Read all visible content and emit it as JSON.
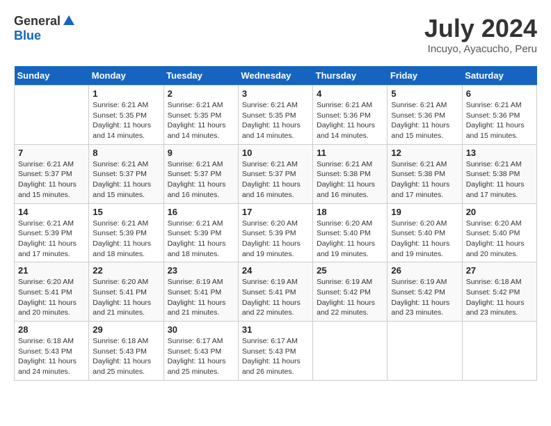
{
  "logo": {
    "general": "General",
    "blue": "Blue"
  },
  "title": {
    "month_year": "July 2024",
    "location": "Incuyo, Ayacucho, Peru"
  },
  "headers": [
    "Sunday",
    "Monday",
    "Tuesday",
    "Wednesday",
    "Thursday",
    "Friday",
    "Saturday"
  ],
  "weeks": [
    [
      {
        "day": "",
        "sunrise": "",
        "sunset": "",
        "daylight": ""
      },
      {
        "day": "1",
        "sunrise": "Sunrise: 6:21 AM",
        "sunset": "Sunset: 5:35 PM",
        "daylight": "Daylight: 11 hours and 14 minutes."
      },
      {
        "day": "2",
        "sunrise": "Sunrise: 6:21 AM",
        "sunset": "Sunset: 5:35 PM",
        "daylight": "Daylight: 11 hours and 14 minutes."
      },
      {
        "day": "3",
        "sunrise": "Sunrise: 6:21 AM",
        "sunset": "Sunset: 5:35 PM",
        "daylight": "Daylight: 11 hours and 14 minutes."
      },
      {
        "day": "4",
        "sunrise": "Sunrise: 6:21 AM",
        "sunset": "Sunset: 5:36 PM",
        "daylight": "Daylight: 11 hours and 14 minutes."
      },
      {
        "day": "5",
        "sunrise": "Sunrise: 6:21 AM",
        "sunset": "Sunset: 5:36 PM",
        "daylight": "Daylight: 11 hours and 15 minutes."
      },
      {
        "day": "6",
        "sunrise": "Sunrise: 6:21 AM",
        "sunset": "Sunset: 5:36 PM",
        "daylight": "Daylight: 11 hours and 15 minutes."
      }
    ],
    [
      {
        "day": "7",
        "sunrise": "Sunrise: 6:21 AM",
        "sunset": "Sunset: 5:37 PM",
        "daylight": "Daylight: 11 hours and 15 minutes."
      },
      {
        "day": "8",
        "sunrise": "Sunrise: 6:21 AM",
        "sunset": "Sunset: 5:37 PM",
        "daylight": "Daylight: 11 hours and 15 minutes."
      },
      {
        "day": "9",
        "sunrise": "Sunrise: 6:21 AM",
        "sunset": "Sunset: 5:37 PM",
        "daylight": "Daylight: 11 hours and 16 minutes."
      },
      {
        "day": "10",
        "sunrise": "Sunrise: 6:21 AM",
        "sunset": "Sunset: 5:37 PM",
        "daylight": "Daylight: 11 hours and 16 minutes."
      },
      {
        "day": "11",
        "sunrise": "Sunrise: 6:21 AM",
        "sunset": "Sunset: 5:38 PM",
        "daylight": "Daylight: 11 hours and 16 minutes."
      },
      {
        "day": "12",
        "sunrise": "Sunrise: 6:21 AM",
        "sunset": "Sunset: 5:38 PM",
        "daylight": "Daylight: 11 hours and 17 minutes."
      },
      {
        "day": "13",
        "sunrise": "Sunrise: 6:21 AM",
        "sunset": "Sunset: 5:38 PM",
        "daylight": "Daylight: 11 hours and 17 minutes."
      }
    ],
    [
      {
        "day": "14",
        "sunrise": "Sunrise: 6:21 AM",
        "sunset": "Sunset: 5:39 PM",
        "daylight": "Daylight: 11 hours and 17 minutes."
      },
      {
        "day": "15",
        "sunrise": "Sunrise: 6:21 AM",
        "sunset": "Sunset: 5:39 PM",
        "daylight": "Daylight: 11 hours and 18 minutes."
      },
      {
        "day": "16",
        "sunrise": "Sunrise: 6:21 AM",
        "sunset": "Sunset: 5:39 PM",
        "daylight": "Daylight: 11 hours and 18 minutes."
      },
      {
        "day": "17",
        "sunrise": "Sunrise: 6:20 AM",
        "sunset": "Sunset: 5:39 PM",
        "daylight": "Daylight: 11 hours and 19 minutes."
      },
      {
        "day": "18",
        "sunrise": "Sunrise: 6:20 AM",
        "sunset": "Sunset: 5:40 PM",
        "daylight": "Daylight: 11 hours and 19 minutes."
      },
      {
        "day": "19",
        "sunrise": "Sunrise: 6:20 AM",
        "sunset": "Sunset: 5:40 PM",
        "daylight": "Daylight: 11 hours and 19 minutes."
      },
      {
        "day": "20",
        "sunrise": "Sunrise: 6:20 AM",
        "sunset": "Sunset: 5:40 PM",
        "daylight": "Daylight: 11 hours and 20 minutes."
      }
    ],
    [
      {
        "day": "21",
        "sunrise": "Sunrise: 6:20 AM",
        "sunset": "Sunset: 5:41 PM",
        "daylight": "Daylight: 11 hours and 20 minutes."
      },
      {
        "day": "22",
        "sunrise": "Sunrise: 6:20 AM",
        "sunset": "Sunset: 5:41 PM",
        "daylight": "Daylight: 11 hours and 21 minutes."
      },
      {
        "day": "23",
        "sunrise": "Sunrise: 6:19 AM",
        "sunset": "Sunset: 5:41 PM",
        "daylight": "Daylight: 11 hours and 21 minutes."
      },
      {
        "day": "24",
        "sunrise": "Sunrise: 6:19 AM",
        "sunset": "Sunset: 5:41 PM",
        "daylight": "Daylight: 11 hours and 22 minutes."
      },
      {
        "day": "25",
        "sunrise": "Sunrise: 6:19 AM",
        "sunset": "Sunset: 5:42 PM",
        "daylight": "Daylight: 11 hours and 22 minutes."
      },
      {
        "day": "26",
        "sunrise": "Sunrise: 6:19 AM",
        "sunset": "Sunset: 5:42 PM",
        "daylight": "Daylight: 11 hours and 23 minutes."
      },
      {
        "day": "27",
        "sunrise": "Sunrise: 6:18 AM",
        "sunset": "Sunset: 5:42 PM",
        "daylight": "Daylight: 11 hours and 23 minutes."
      }
    ],
    [
      {
        "day": "28",
        "sunrise": "Sunrise: 6:18 AM",
        "sunset": "Sunset: 5:43 PM",
        "daylight": "Daylight: 11 hours and 24 minutes."
      },
      {
        "day": "29",
        "sunrise": "Sunrise: 6:18 AM",
        "sunset": "Sunset: 5:43 PM",
        "daylight": "Daylight: 11 hours and 25 minutes."
      },
      {
        "day": "30",
        "sunrise": "Sunrise: 6:17 AM",
        "sunset": "Sunset: 5:43 PM",
        "daylight": "Daylight: 11 hours and 25 minutes."
      },
      {
        "day": "31",
        "sunrise": "Sunrise: 6:17 AM",
        "sunset": "Sunset: 5:43 PM",
        "daylight": "Daylight: 11 hours and 26 minutes."
      },
      {
        "day": "",
        "sunrise": "",
        "sunset": "",
        "daylight": ""
      },
      {
        "day": "",
        "sunrise": "",
        "sunset": "",
        "daylight": ""
      },
      {
        "day": "",
        "sunrise": "",
        "sunset": "",
        "daylight": ""
      }
    ]
  ]
}
